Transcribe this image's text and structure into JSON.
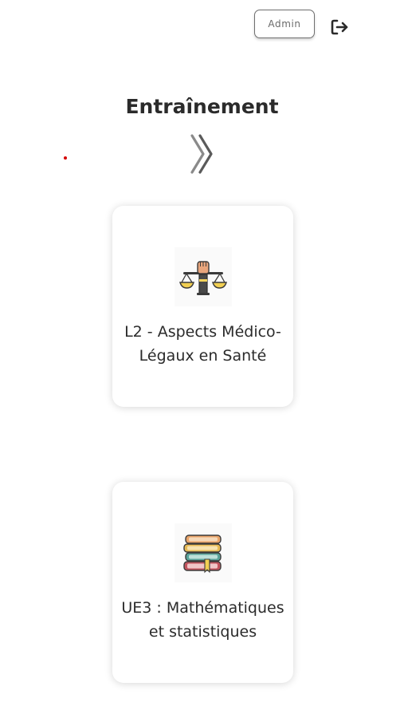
{
  "header": {
    "admin_label": "Admin",
    "logout_icon": "sign-out-icon"
  },
  "main": {
    "title": "Entraînement",
    "chevron_icon": "double-chevron-right-icon"
  },
  "courses": [
    {
      "label": "L2 - Aspects Médico-\nLégaux en Santé",
      "icon": "scales-of-justice-icon"
    },
    {
      "label": "UE3 : Mathématiques\net statistiques",
      "icon": "stack-of-books-icon"
    }
  ],
  "colors": {
    "text": "#2b2b2b",
    "admin_border": "#6f6f6f",
    "accent_dot": "#d40000"
  }
}
